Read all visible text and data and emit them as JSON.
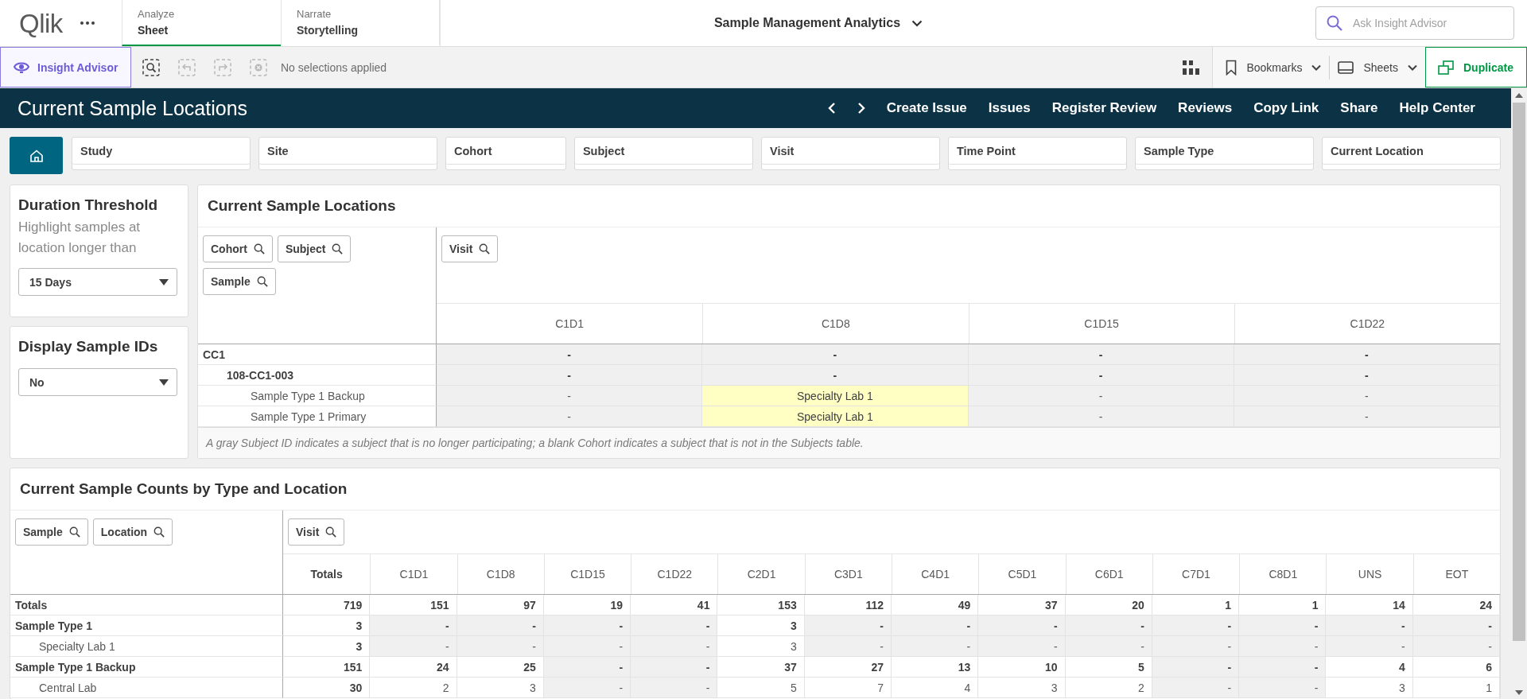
{
  "app_bar": {
    "logo": "Qlik",
    "tabs": [
      {
        "caption": "Analyze",
        "label": "Sheet",
        "selected": true
      },
      {
        "caption": "Narrate",
        "label": "Storytelling",
        "selected": false
      }
    ],
    "title": "Sample Management Analytics",
    "search": {
      "placeholder": "Ask Insight Advisor"
    }
  },
  "toolbar": {
    "insight_button": "Insight Advisor",
    "tools": [
      {
        "kind": "smart-search",
        "disabled": false
      },
      {
        "kind": "back",
        "disabled": true
      },
      {
        "kind": "forward",
        "disabled": true
      },
      {
        "kind": "clear",
        "disabled": true
      }
    ],
    "selections": "No selections applied",
    "bookmarks": "Bookmarks",
    "sheets": "Sheets",
    "duplicate": "Duplicate"
  },
  "sheet_header": {
    "title": "Current Sample Locations",
    "links": [
      "Create Issue",
      "Issues",
      "Register Review",
      "Reviews",
      "Copy Link",
      "Share",
      "Help Center"
    ]
  },
  "filters": [
    "Study",
    "Site",
    "Cohort",
    "Subject",
    "Visit",
    "Time Point",
    "Sample Type",
    "Current Location"
  ],
  "duration_panel": {
    "title": "Duration Threshold",
    "subtitle": "Highlight samples at location longer than",
    "value": "15 Days"
  },
  "display_panel": {
    "title": "Display Sample IDs",
    "value": "No"
  },
  "locations_table": {
    "title": "Current Sample Locations",
    "row_dimensions": [
      "Cohort",
      "Subject",
      "Sample"
    ],
    "column_dimension": "Visit",
    "columns": [
      "C1D1",
      "C1D8",
      "C1D15",
      "C1D22"
    ],
    "rows": [
      {
        "label": "CC1",
        "cells": [
          {
            "value": "-",
            "highlighted": false
          },
          {
            "value": "-",
            "highlighted": false
          },
          {
            "value": "-",
            "highlighted": false
          },
          {
            "value": "-",
            "highlighted": false
          }
        ],
        "children": [
          {
            "label": "108-CC1-003",
            "cells": [
              {
                "value": "-",
                "highlighted": false
              },
              {
                "value": "-",
                "highlighted": false
              },
              {
                "value": "-",
                "highlighted": false
              },
              {
                "value": "-",
                "highlighted": false
              }
            ],
            "children": [
              {
                "label": "Sample Type 1 Backup",
                "cells": [
                  {
                    "value": "-",
                    "highlighted": false
                  },
                  {
                    "value": "Specialty Lab 1",
                    "highlighted": true
                  },
                  {
                    "value": "-",
                    "highlighted": false
                  },
                  {
                    "value": "-",
                    "highlighted": false
                  }
                ]
              },
              {
                "label": "Sample Type 1 Primary",
                "cells": [
                  {
                    "value": "-",
                    "highlighted": false
                  },
                  {
                    "value": "Specialty Lab 1",
                    "highlighted": true
                  },
                  {
                    "value": "-",
                    "highlighted": false
                  },
                  {
                    "value": "-",
                    "highlighted": false
                  }
                ]
              }
            ]
          }
        ]
      }
    ],
    "footnote": "A gray Subject ID indicates a subject that is no longer participating; a blank Cohort indicates a subject that is not in the Subjects table."
  },
  "counts_table": {
    "title": "Current Sample Counts by Type and Location",
    "row_dimensions": [
      "Sample",
      "Location"
    ],
    "column_dimension": "Visit",
    "totals_column": "Totals",
    "columns": [
      "C1D1",
      "C1D8",
      "C1D15",
      "C1D22",
      "C2D1",
      "C3D1",
      "C4D1",
      "C5D1",
      "C6D1",
      "C7D1",
      "C8D1",
      "UNS",
      "EOT"
    ],
    "totals_row": {
      "label": "Totals",
      "cells": [
        {
          "value": "719",
          "shaded": false
        },
        {
          "value": "151",
          "shaded": false
        },
        {
          "value": "97",
          "shaded": false
        },
        {
          "value": "19",
          "shaded": false
        },
        {
          "value": "41",
          "shaded": false
        },
        {
          "value": "153",
          "shaded": false
        },
        {
          "value": "112",
          "shaded": false
        },
        {
          "value": "49",
          "shaded": false
        },
        {
          "value": "37",
          "shaded": false
        },
        {
          "value": "20",
          "shaded": false
        },
        {
          "value": "1",
          "shaded": false
        },
        {
          "value": "1",
          "shaded": false
        },
        {
          "value": "14",
          "shaded": false
        },
        {
          "value": "24",
          "shaded": false
        }
      ]
    },
    "rows": [
      {
        "label": "Sample Type 1",
        "cells": [
          {
            "value": "3",
            "shaded": false
          },
          {
            "value": "-",
            "shaded": true
          },
          {
            "value": "-",
            "shaded": true
          },
          {
            "value": "-",
            "shaded": true
          },
          {
            "value": "-",
            "shaded": true
          },
          {
            "value": "3",
            "shaded": false
          },
          {
            "value": "-",
            "shaded": true
          },
          {
            "value": "-",
            "shaded": true
          },
          {
            "value": "-",
            "shaded": true
          },
          {
            "value": "-",
            "shaded": true
          },
          {
            "value": "-",
            "shaded": true
          },
          {
            "value": "-",
            "shaded": true
          },
          {
            "value": "-",
            "shaded": true
          },
          {
            "value": "-",
            "shaded": true
          }
        ],
        "children": [
          {
            "label": "Specialty Lab 1",
            "cells": [
              {
                "value": "3",
                "shaded": false
              },
              {
                "value": "-",
                "shaded": true
              },
              {
                "value": "-",
                "shaded": true
              },
              {
                "value": "-",
                "shaded": true
              },
              {
                "value": "-",
                "shaded": true
              },
              {
                "value": "3",
                "shaded": false
              },
              {
                "value": "-",
                "shaded": true
              },
              {
                "value": "-",
                "shaded": true
              },
              {
                "value": "-",
                "shaded": true
              },
              {
                "value": "-",
                "shaded": true
              },
              {
                "value": "-",
                "shaded": true
              },
              {
                "value": "-",
                "shaded": true
              },
              {
                "value": "-",
                "shaded": true
              },
              {
                "value": "-",
                "shaded": true
              }
            ]
          }
        ]
      },
      {
        "label": "Sample Type 1 Backup",
        "cells": [
          {
            "value": "151",
            "shaded": false
          },
          {
            "value": "24",
            "shaded": false
          },
          {
            "value": "25",
            "shaded": false
          },
          {
            "value": "-",
            "shaded": true
          },
          {
            "value": "-",
            "shaded": true
          },
          {
            "value": "37",
            "shaded": false
          },
          {
            "value": "27",
            "shaded": false
          },
          {
            "value": "13",
            "shaded": false
          },
          {
            "value": "10",
            "shaded": false
          },
          {
            "value": "5",
            "shaded": false
          },
          {
            "value": "-",
            "shaded": true
          },
          {
            "value": "-",
            "shaded": true
          },
          {
            "value": "4",
            "shaded": false
          },
          {
            "value": "6",
            "shaded": false
          }
        ],
        "children": [
          {
            "label": "Central Lab",
            "cells": [
              {
                "value": "30",
                "shaded": false
              },
              {
                "value": "2",
                "shaded": false
              },
              {
                "value": "3",
                "shaded": false
              },
              {
                "value": "-",
                "shaded": true
              },
              {
                "value": "-",
                "shaded": true
              },
              {
                "value": "5",
                "shaded": false
              },
              {
                "value": "7",
                "shaded": false
              },
              {
                "value": "4",
                "shaded": false
              },
              {
                "value": "3",
                "shaded": false
              },
              {
                "value": "2",
                "shaded": false
              },
              {
                "value": "-",
                "shaded": true
              },
              {
                "value": "-",
                "shaded": true
              },
              {
                "value": "3",
                "shaded": false
              },
              {
                "value": "1",
                "shaded": false
              }
            ]
          }
        ]
      }
    ]
  }
}
